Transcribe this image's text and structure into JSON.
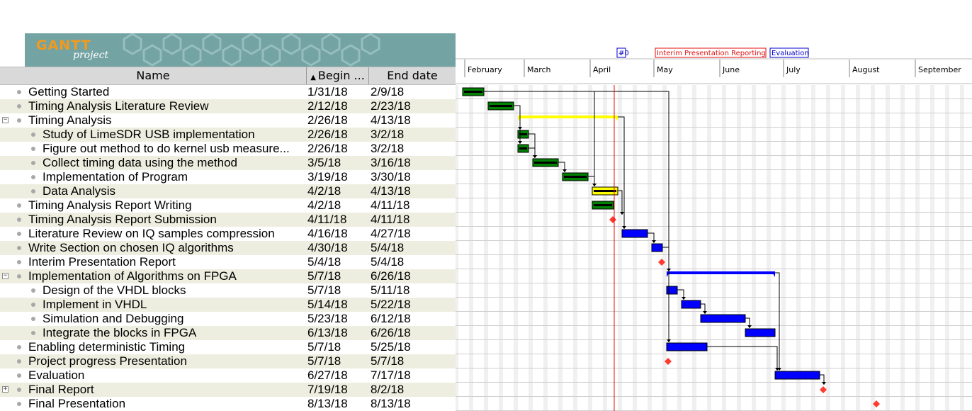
{
  "logo": {
    "brand": "GANTT",
    "sub": "project"
  },
  "columns": {
    "name": "Name",
    "begin": "Begin ...",
    "end": "End date"
  },
  "tasks": [
    {
      "name": "Getting Started",
      "begin": "1/31/18",
      "end": "2/9/18",
      "level": 0,
      "expander": "",
      "color": "#008000",
      "type": "task"
    },
    {
      "name": "Timing Analysis Literature Review",
      "begin": "2/12/18",
      "end": "2/23/18",
      "level": 0,
      "expander": "",
      "color": "#008000",
      "type": "task"
    },
    {
      "name": "Timing Analysis",
      "begin": "2/26/18",
      "end": "4/13/18",
      "level": 0,
      "expander": "−",
      "color": "#ffff00",
      "type": "summary"
    },
    {
      "name": "Study of LimeSDR USB implementation",
      "begin": "2/26/18",
      "end": "3/2/18",
      "level": 1,
      "expander": "",
      "color": "#008000",
      "type": "task"
    },
    {
      "name": "Figure out method to do kernel usb measure...",
      "begin": "2/26/18",
      "end": "3/2/18",
      "level": 1,
      "expander": "",
      "color": "#008000",
      "type": "task"
    },
    {
      "name": "Collect timing data using the method",
      "begin": "3/5/18",
      "end": "3/16/18",
      "level": 1,
      "expander": "",
      "color": "#008000",
      "type": "task"
    },
    {
      "name": "Implementation of Program",
      "begin": "3/19/18",
      "end": "3/30/18",
      "level": 1,
      "expander": "",
      "color": "#008000",
      "type": "task"
    },
    {
      "name": "Data Analysis",
      "begin": "4/2/18",
      "end": "4/13/18",
      "level": 1,
      "expander": "",
      "color": "#ffff00",
      "type": "task"
    },
    {
      "name": "Timing Analysis Report Writing",
      "begin": "4/2/18",
      "end": "4/11/18",
      "level": 0,
      "expander": "",
      "color": "#008000",
      "type": "task"
    },
    {
      "name": "Timing Analysis Report Submission",
      "begin": "4/11/18",
      "end": "4/11/18",
      "level": 0,
      "expander": "",
      "color": "#ff3b30",
      "type": "milestone"
    },
    {
      "name": "Literature Review on IQ samples compression",
      "begin": "4/16/18",
      "end": "4/27/18",
      "level": 0,
      "expander": "",
      "color": "#0000ff",
      "type": "task"
    },
    {
      "name": "Write Section on chosen IQ algorithms",
      "begin": "4/30/18",
      "end": "5/4/18",
      "level": 0,
      "expander": "",
      "color": "#0000ff",
      "type": "task"
    },
    {
      "name": "Interim Presentation Report",
      "begin": "5/4/18",
      "end": "5/4/18",
      "level": 0,
      "expander": "",
      "color": "#ff3b30",
      "type": "milestone"
    },
    {
      "name": "Implementation of Algorithms on FPGA",
      "begin": "5/7/18",
      "end": "6/26/18",
      "level": 0,
      "expander": "−",
      "color": "#0000ff",
      "type": "summary"
    },
    {
      "name": "Design of the VHDL blocks",
      "begin": "5/7/18",
      "end": "5/11/18",
      "level": 1,
      "expander": "",
      "color": "#0000ff",
      "type": "task"
    },
    {
      "name": "Implement in VHDL",
      "begin": "5/14/18",
      "end": "5/22/18",
      "level": 1,
      "expander": "",
      "color": "#0000ff",
      "type": "task"
    },
    {
      "name": "Simulation and Debugging",
      "begin": "5/23/18",
      "end": "6/12/18",
      "level": 1,
      "expander": "",
      "color": "#0000ff",
      "type": "task"
    },
    {
      "name": "Integrate the blocks in FPGA",
      "begin": "6/13/18",
      "end": "6/26/18",
      "level": 1,
      "expander": "",
      "color": "#0000ff",
      "type": "task"
    },
    {
      "name": "Enabling deterministic Timing",
      "begin": "5/7/18",
      "end": "5/25/18",
      "level": 0,
      "expander": "",
      "color": "#0000ff",
      "type": "task"
    },
    {
      "name": "Project progress Presentation",
      "begin": "5/7/18",
      "end": "5/7/18",
      "level": 0,
      "expander": "",
      "color": "#ff3b30",
      "type": "milestone"
    },
    {
      "name": "Evaluation",
      "begin": "6/27/18",
      "end": "7/17/18",
      "level": 0,
      "expander": "",
      "color": "#0000ff",
      "type": "task"
    },
    {
      "name": "Final Report",
      "begin": "7/19/18",
      "end": "8/2/18",
      "level": 0,
      "expander": "+",
      "color": "#ff3b30",
      "type": "milestone"
    },
    {
      "name": "Final Presentation",
      "begin": "8/13/18",
      "end": "8/13/18",
      "level": 0,
      "expander": "",
      "color": "#ff3b30",
      "type": "milestone"
    }
  ],
  "timeline": {
    "months": [
      "February",
      "March",
      "April",
      "May",
      "June",
      "July",
      "August",
      "September"
    ],
    "today": "4/12/18",
    "today_color": "#e01010",
    "markers": [
      {
        "label": "#0",
        "color": "#0000cc"
      },
      {
        "label": "Interim Presentation Reporting",
        "color": "#e01010"
      },
      {
        "label": "Evaluation",
        "color": "#0000cc"
      }
    ]
  },
  "dependencies": [
    [
      0,
      13
    ],
    [
      1,
      3
    ],
    [
      1,
      4
    ],
    [
      2,
      10
    ],
    [
      3,
      5
    ],
    [
      4,
      5
    ],
    [
      5,
      6
    ],
    [
      6,
      7
    ],
    [
      0,
      7
    ],
    [
      7,
      9
    ],
    [
      10,
      11
    ],
    [
      11,
      13
    ],
    [
      11,
      18
    ],
    [
      14,
      15
    ],
    [
      15,
      16
    ],
    [
      16,
      17
    ],
    [
      18,
      20
    ],
    [
      13,
      20
    ],
    [
      20,
      21
    ]
  ]
}
